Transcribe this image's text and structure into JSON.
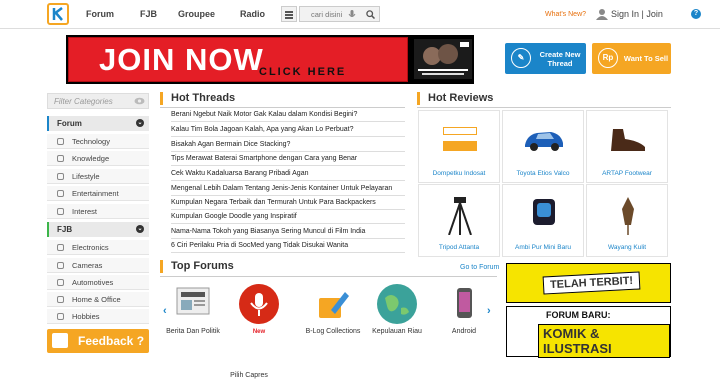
{
  "nav": {
    "forum": "Forum",
    "fjb": "FJB",
    "groupee": "Groupee",
    "radio": "Radio"
  },
  "search": {
    "placeholder": "cari disini"
  },
  "header": {
    "whats_new": "What's New?",
    "sign_in": "Sign In | Join",
    "help": "?"
  },
  "banner": {
    "join_now": "JOIN NOW",
    "click_here": "CLICK HERE"
  },
  "actions": {
    "create_thread": "Create New Thread",
    "want_to_sell": "Want To Sell",
    "sell_icon": "Rp",
    "create_color": "#1b85c9",
    "sell_color": "#f5a623"
  },
  "sidebar": {
    "filter_placeholder": "Filter Categories",
    "forum_label": "Forum",
    "forum_items": [
      "Technology",
      "Knowledge",
      "Lifestyle",
      "Entertainment",
      "Interest"
    ],
    "fjb_label": "FJB",
    "fjb_items": [
      "Electronics",
      "Cameras",
      "Automotives",
      "Home & Office",
      "Hobbies"
    ],
    "feedback": "Feedback ?"
  },
  "hot_threads": {
    "title": "Hot Threads",
    "items": [
      "Berani Ngebut Naik Motor Gak Kalau dalam Kondisi Begini?",
      "Kalau Tim Bola Jagoan Kalah, Apa yang Akan Lo Perbuat?",
      "Bisakah Agan Bermain Dice Stacking?",
      "Tips Merawat Baterai Smartphone dengan Cara yang Benar",
      "Cek Waktu Kadaluarsa Barang Pribadi Agan",
      "Mengenal Lebih Dalam Tentang Jenis-Jenis Kontainer Untuk Pelayaran",
      "Kumpulan Negara Terbaik dan Termurah Untuk Para Backpackers",
      "Kumpulan Google Doodle yang Inspiratif",
      "Nama-Nama Tokoh yang Biasanya Sering Muncul di Film India",
      "6 Ciri Perilaku Pria di SocMed yang Tidak Disukai Wanita"
    ]
  },
  "hot_reviews": {
    "title": "Hot Reviews",
    "items": [
      "Dompetku Indosat",
      "Toyota Etios Valco",
      "ARTAP Footwear",
      "Tripod Attanta",
      "Ambi Pur Mini Baru",
      "Wayang Kulit"
    ]
  },
  "top_forums": {
    "title": "Top Forums",
    "goto": "Go to Forum",
    "items": [
      {
        "label": "Berita Dan Politik",
        "badge": ""
      },
      {
        "label": "Pilih Capres",
        "badge": "New"
      },
      {
        "label": "B-Log Collections",
        "badge": ""
      },
      {
        "label": "Kepulauan Riau",
        "badge": ""
      },
      {
        "label": "Android",
        "badge": ""
      }
    ]
  },
  "side_banners": {
    "telah_terbit": "TELAH TERBIT!",
    "forum_baru": "FORUM BARU:",
    "komik": "KOMIK & ILUSTRASI"
  }
}
